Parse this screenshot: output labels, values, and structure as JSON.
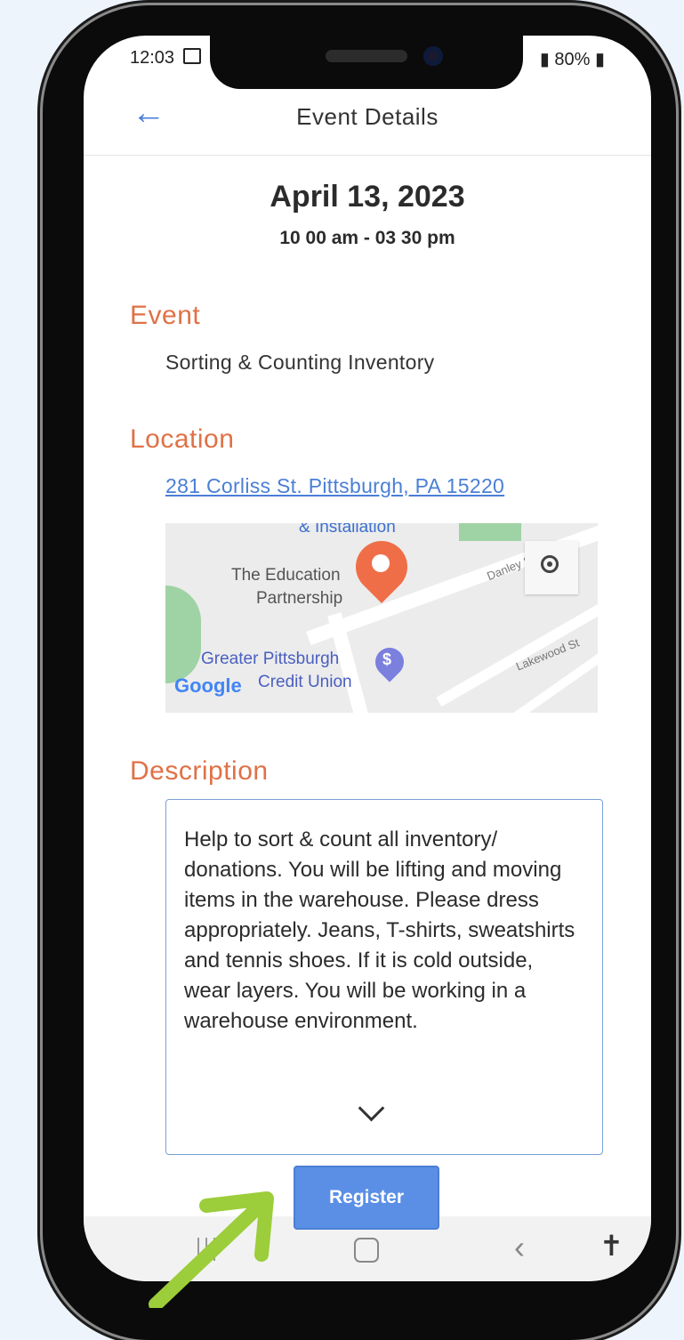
{
  "status": {
    "time": "12:03",
    "battery": "80%"
  },
  "header": {
    "title": "Event Details"
  },
  "event": {
    "date": "April 13, 2023",
    "time": "10 00 am - 03 30 pm",
    "event_label": "Event",
    "event_name": "Sorting & Counting Inventory",
    "location_label": "Location",
    "address": "281 Corliss St.  Pittsburgh, PA  15220",
    "description_label": "Description",
    "description": "Help to sort & count all inventory/ donations. You will be lifting and moving items in the warehouse. Please dress appropriately. Jeans, T-shirts, sweatshirts and tennis shoes. If it is cold outside, wear layers. You will be working in a warehouse environment."
  },
  "map": {
    "top_label": "& Installation",
    "place1_line1": "The Education",
    "place1_line2": "Partnership",
    "place2_line1": "Greater Pittsburgh",
    "place2_line2": "Credit Union",
    "street1": "Danley St",
    "street2": "Lakewood St",
    "google": "Google",
    "bank_symbol": "$"
  },
  "actions": {
    "register_label": "Register"
  },
  "colors": {
    "accent": "#e07146",
    "link": "#4a7fd6",
    "button": "#5b8fe6",
    "arrow": "#9ccd3a"
  }
}
